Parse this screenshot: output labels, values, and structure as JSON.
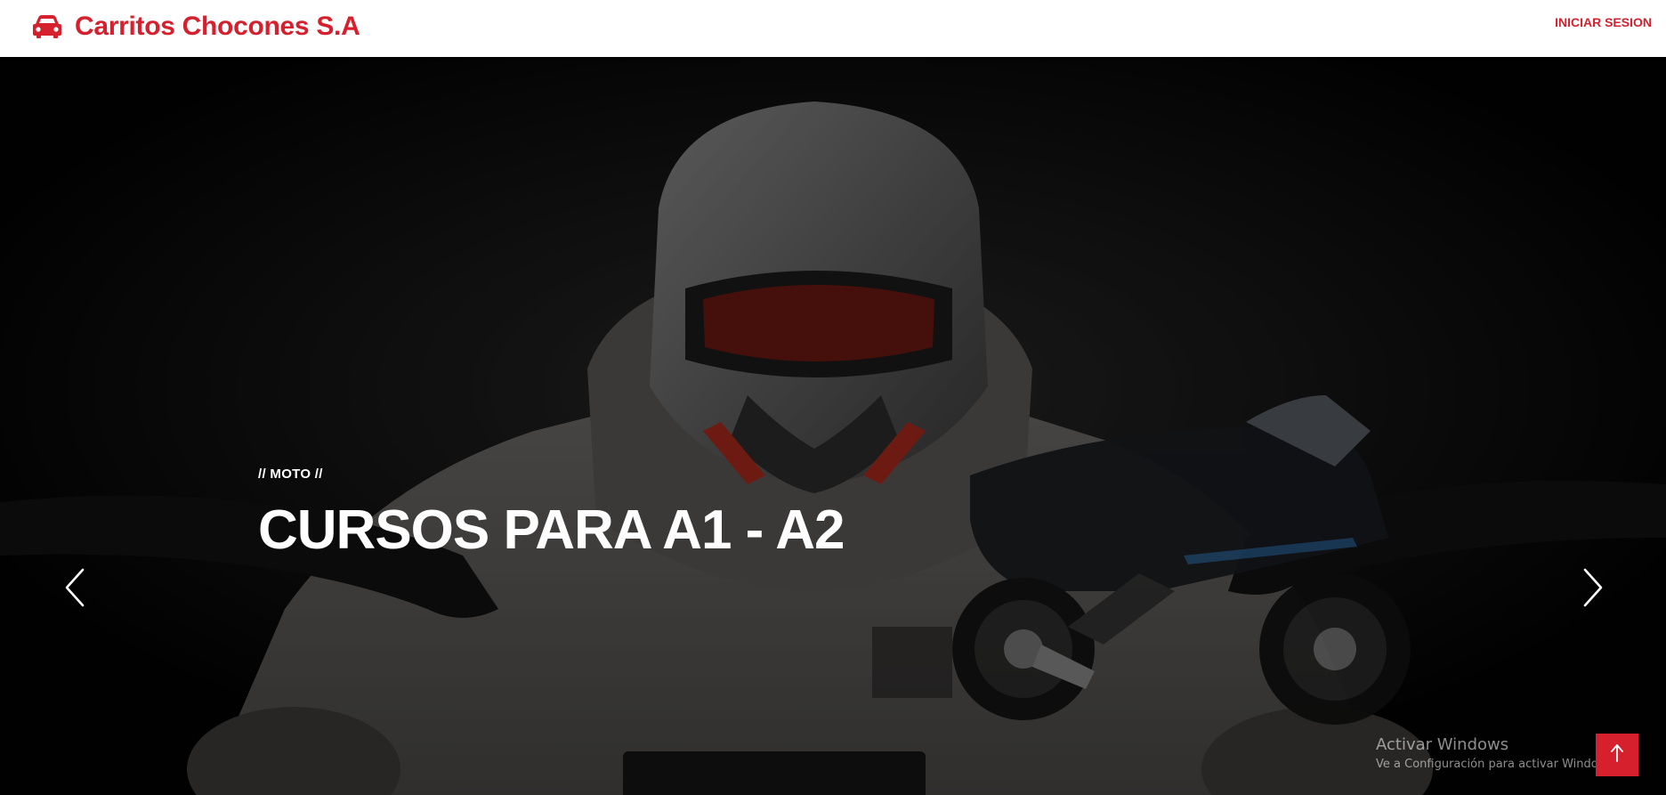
{
  "header": {
    "brand_name": "Carritos Chocones S.A",
    "brand_icon": "car-icon",
    "login_label": "INICIAR SESION"
  },
  "hero": {
    "subtitle": "// MOTO //",
    "title": "CURSOS PARA A1 - A2",
    "prev_icon": "chevron-left-icon",
    "next_icon": "chevron-right-icon",
    "photo_description_icon": "motorcycle-rider-photo"
  },
  "watermark": {
    "title": "Activar Windows",
    "subtitle": "Ve a Configuración para activar Windows."
  },
  "back_to_top": {
    "icon": "arrow-up-icon"
  },
  "colors": {
    "brand_red": "#d6202e",
    "navbar_bg": "#ffffff",
    "hero_bg": "#050505",
    "text_light": "#ffffff"
  }
}
